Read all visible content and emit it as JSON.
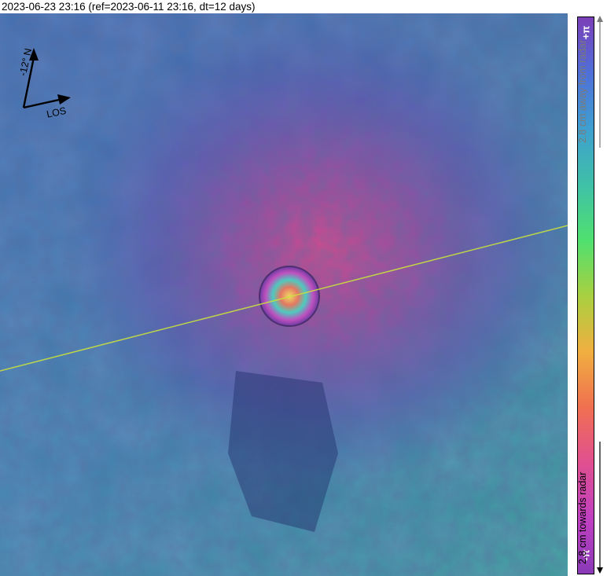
{
  "header": {
    "title": "2023-06-23 23:16 (ref=2023-06-11 23:16, dt=12 days)"
  },
  "compass": {
    "north_label": "-12° N",
    "los_label": "LOS"
  },
  "colorbar": {
    "top_label": "+π",
    "bottom_label": "-π",
    "away_label": "2.8 cm away from radar",
    "towards_label": "2.8 cm towards radar",
    "colors": [
      "#7b3fb8",
      "#4f6fd8",
      "#3f9fd0",
      "#3fc0a8",
      "#4fe070",
      "#a8d040",
      "#f0b040",
      "#f07050",
      "#e05090",
      "#c040c0",
      "#8a3ab8"
    ]
  },
  "map": {
    "base_color": "#3a5fa8",
    "summit_color": "#d0408a",
    "trace_color": "#c8e040"
  }
}
